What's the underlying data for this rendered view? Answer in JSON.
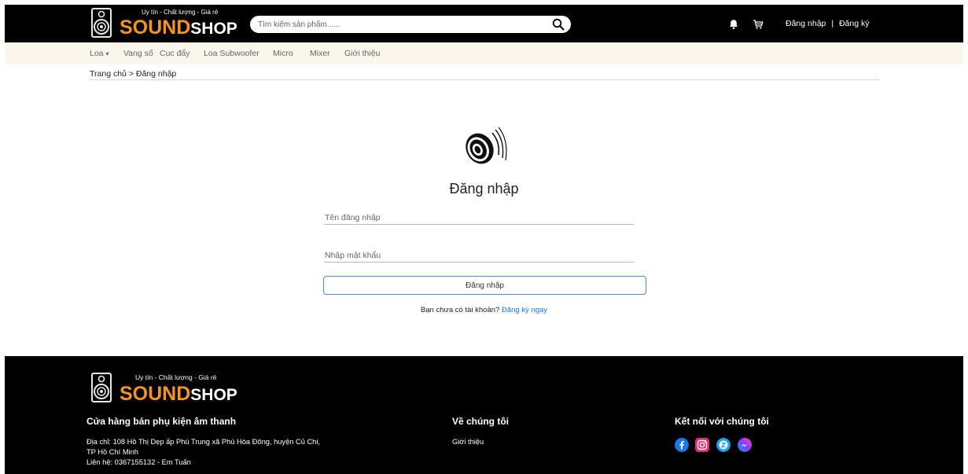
{
  "header": {
    "logo_tagline": "Uy tín - Chất lượng - Giá rẻ",
    "logo_brand_1": "SOUND",
    "logo_brand_2": "SHOP",
    "search_placeholder": "Tìm kiếm sản phẩm......",
    "login_link": "Đăng nhập",
    "separator": "|",
    "register_link": "Đăng ký"
  },
  "nav": {
    "items": [
      "Loa",
      "Vang số",
      "Cục đẩy",
      "Loa Subwoofer",
      "Micro",
      "Mixer",
      "Giới thiệu"
    ],
    "dropdown_caret": "▾"
  },
  "breadcrumb": {
    "home": "Trang chủ",
    "separator": ">",
    "current": "Đăng nhập"
  },
  "login": {
    "title": "Đăng nhập",
    "username_placeholder": "Tên đăng nhập",
    "password_placeholder": "Nhập mật khẩu",
    "submit_label": "Đăng nhập",
    "no_account_text": "Bạn chưa có tài khoản?",
    "signup_link": "Đăng ký ngay"
  },
  "footer": {
    "logo_tagline": "Uy tín - Chất lượng - Giá rẻ",
    "logo_brand_1": "SOUND",
    "logo_brand_2": "SHOP",
    "store_heading": "Cửa hàng bán phụ kiện âm thanh",
    "address_line_1": "Địa chỉ: 108 Hồ Thị Dẹp ấp Phú Trung xã Phú Hòa Đông, huyện Củ Chi,",
    "address_line_2": "TP Hồ Chí Minh",
    "contact": "Liên hệ: 0367155132 - Em Tuấn",
    "about_heading": "Về chúng tôi",
    "about_link": "Giới thiệu",
    "connect_heading": "Kết nối với chúng tôi"
  },
  "colors": {
    "brand_orange": "#f7941d",
    "link_blue": "#1a73e8",
    "nav_bg": "#fbf6ec",
    "button_border": "#4e88d6"
  },
  "icons": {
    "notification": "bell-icon",
    "cart": "cart-icon",
    "search": "search-icon",
    "facebook": "facebook-icon",
    "instagram": "instagram-icon",
    "zalo": "zalo-icon",
    "messenger": "messenger-icon"
  }
}
